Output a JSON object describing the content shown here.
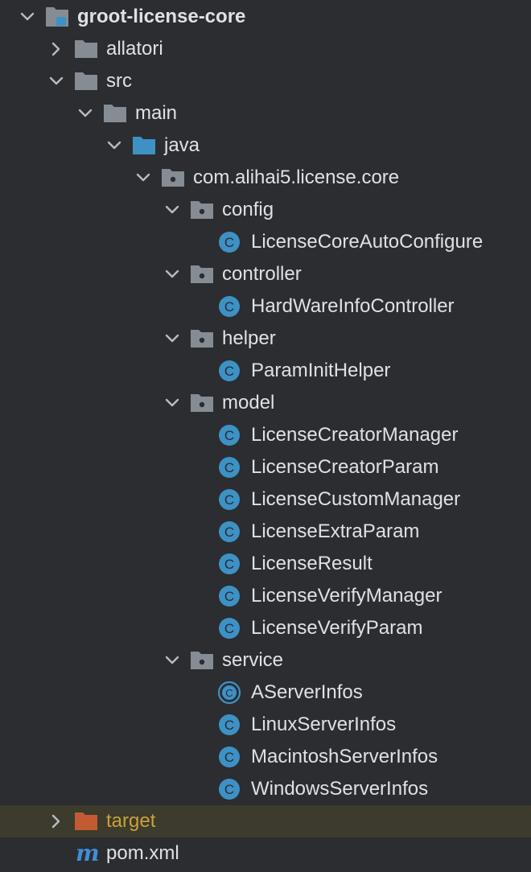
{
  "colors": {
    "background": "#2b2d30",
    "text": "#dfe1e5",
    "folder_gray": "#868c93",
    "folder_source_blue": "#3d91c5",
    "folder_excluded_orange": "#c35a32",
    "class_blue": "#3d91c5",
    "target_text": "#c9a13a",
    "highlight_row": "#3d3a2e",
    "maven_blue": "#3f8ed6"
  },
  "tree": {
    "rows": [
      {
        "label": "groot-license-core",
        "icon": "module-folder-icon",
        "chevron": "down",
        "bold": true
      },
      {
        "label": "allatori",
        "icon": "folder-icon",
        "chevron": "right"
      },
      {
        "label": "src",
        "icon": "folder-icon",
        "chevron": "down"
      },
      {
        "label": "main",
        "icon": "folder-icon",
        "chevron": "down"
      },
      {
        "label": "java",
        "icon": "source-folder-icon",
        "chevron": "down"
      },
      {
        "label": "com.alihai5.license.core",
        "icon": "package-icon",
        "chevron": "down"
      },
      {
        "label": "config",
        "icon": "package-icon",
        "chevron": "down"
      },
      {
        "label": "LicenseCoreAutoConfigure",
        "icon": "class-icon"
      },
      {
        "label": "controller",
        "icon": "package-icon",
        "chevron": "down"
      },
      {
        "label": "HardWareInfoController",
        "icon": "class-icon"
      },
      {
        "label": "helper",
        "icon": "package-icon",
        "chevron": "down"
      },
      {
        "label": "ParamInitHelper",
        "icon": "class-icon"
      },
      {
        "label": "model",
        "icon": "package-icon",
        "chevron": "down"
      },
      {
        "label": "LicenseCreatorManager",
        "icon": "class-icon"
      },
      {
        "label": "LicenseCreatorParam",
        "icon": "class-icon"
      },
      {
        "label": "LicenseCustomManager",
        "icon": "class-icon"
      },
      {
        "label": "LicenseExtraParam",
        "icon": "class-icon"
      },
      {
        "label": "LicenseResult",
        "icon": "class-icon"
      },
      {
        "label": "LicenseVerifyManager",
        "icon": "class-icon"
      },
      {
        "label": "LicenseVerifyParam",
        "icon": "class-icon"
      },
      {
        "label": "service",
        "icon": "package-icon",
        "chevron": "down"
      },
      {
        "label": "AServerInfos",
        "icon": "abstract-class-icon"
      },
      {
        "label": "LinuxServerInfos",
        "icon": "class-icon"
      },
      {
        "label": "MacintoshServerInfos",
        "icon": "class-icon"
      },
      {
        "label": "WindowsServerInfos",
        "icon": "class-icon"
      },
      {
        "label": "target",
        "icon": "excluded-folder-icon",
        "chevron": "right",
        "highlight": true
      },
      {
        "label": "pom.xml",
        "icon": "maven-icon",
        "icon_text": "m"
      }
    ]
  }
}
